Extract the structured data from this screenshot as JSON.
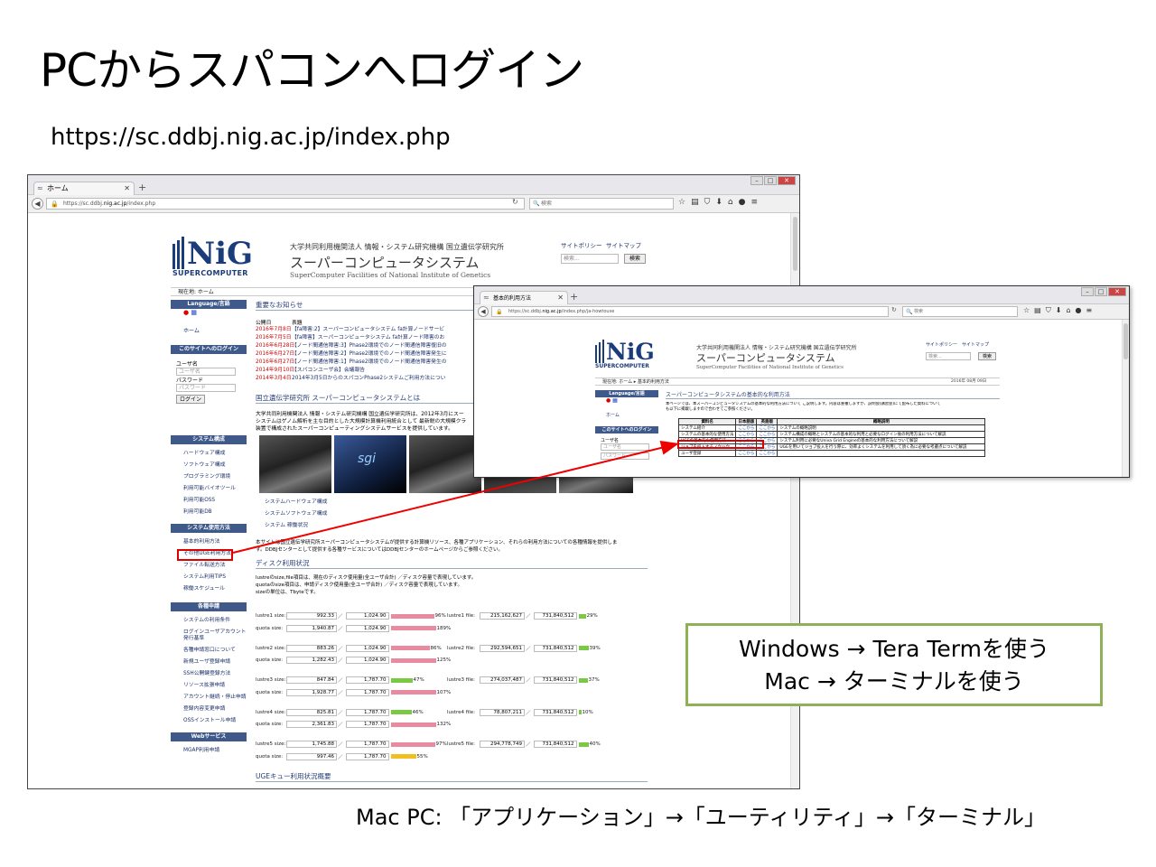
{
  "slide": {
    "title": "PCからスパコンへログイン",
    "url": "https://sc.ddbj.nig.ac.jp/index.php",
    "note_line1": "Windows → Tera Termを使う",
    "note_line2": "Mac → ターミナルを使う",
    "footer": "Mac PC: 「アプリケーション」→「ユーティリティ」→「ターミナル」"
  },
  "browser1": {
    "tab_label": "ホーム",
    "address_prefix": "https://sc.ddbj.",
    "address_domain": "nig.ac.jp",
    "address_suffix": "/index.php",
    "search_placeholder": "検索",
    "page": {
      "logo_text": "NiG",
      "logo_sub": "SUPERCOMPUTER",
      "org": "大学共同利用機関法人 情報・システム研究機構 国立遺伝学研究所",
      "system_name": "スーパーコンピュータシステム",
      "system_name_en": "SuperComputer Facilities of National Institute of Genetics",
      "links": [
        "サイトポリシー",
        "サイトマップ"
      ],
      "search_box": "検索...",
      "search_button": "検索",
      "breadcrumb": "現在地: ホーム",
      "sidebar": {
        "language_head": "Language/言語",
        "home": "ホーム",
        "login_head": "このサイトへのログイン",
        "user_label": "ユーザ名",
        "user_placeholder": "ユーザ名",
        "pass_label": "パスワード",
        "pass_placeholder": "パスワード",
        "login_button": "ログイン",
        "system_head": "システム構成",
        "system_items": [
          "ハードウェア構成",
          "ソフトウェア構成",
          "プログラミング環境",
          "利用可能バイオツール",
          "利用可能OSS",
          "利用可能DB"
        ],
        "usage_head": "システム使用方法",
        "usage_items": [
          "基本的利用方法",
          "その他UGE利用方法",
          "ファイル転送方法",
          "システム利用TIPS",
          "稼働スケジュール"
        ],
        "apply_head": "各種申請",
        "apply_items": [
          "システムの利用条件",
          "ログインユーザアカウント発行基準",
          "各種申請窓口について",
          "新規ユーザ登録申請",
          "SSH公開鍵登録方法",
          "リソース拡張申請",
          "アカウント継続・停止申請",
          "登録内容変更申請",
          "OSSインストール申請"
        ],
        "web_head": "Webサービス",
        "web_items": [
          "MGAP利用申請"
        ]
      },
      "notice_title": "重要なお知らせ",
      "notice_header": [
        "公開日",
        "表題"
      ],
      "notices": [
        {
          "date": "2016年7月8日",
          "title": "【fa障害:2】スーパーコンピュータシステム fa計算ノードサービ"
        },
        {
          "date": "2016年7月5日",
          "title": "【fa障害】スーパーコンピュータシステム fa計算ノード障害のお"
        },
        {
          "date": "2016年6月28日",
          "title": "【ノード間通信障害:3】Phase2環境でのノード間通信障害復旧の"
        },
        {
          "date": "2016年6月27日",
          "title": "【ノード間通信障害:2】Phase2環境でのノード間通信障害発生に"
        },
        {
          "date": "2016年6月27日",
          "title": "【ノード間通信障害:1】Phase2環境でのノード間通信障害発生の"
        },
        {
          "date": "2014年9月10日",
          "title": "【スパコンユーザ会】会議報告"
        },
        {
          "date": "2014年3月4日",
          "title": "2014年3月5日からのスパコンPhase2システムご利用方法につい"
        }
      ],
      "about_title": "国立遺伝学研究所 スーパーコンピュータシステムとは",
      "about_text1": "大学共同利用機関法人 情報・システム研究機構 国立遺伝学研究所は、2012年3月にスー",
      "about_text2": "システムはゲノム解析を主な目的とした大規模計算機利用統合として 最新鋭の大規模クラ",
      "about_text3": "装置で構成されたスーパーコンピューティングシステムサービスを提供しています。",
      "photo_links": [
        "システムハードウェア構成",
        "システムソフトウェア構成",
        "システム 稼働状況"
      ],
      "service_text1": "本サイトは国立遺伝学研究所スーパーコンピュータシステムが提供する計算機リソース、各種アプリケーション、それらの利用方法についての各種情報を提供しま",
      "service_text2": "す。DDBJセンターとして提供する各種サービスについてはDDBJセンターのホームページからご参照ください。",
      "disk_title": "ディスク利用状況",
      "disk_text1": "lustreのsize,file項目は、現在のディスク使用量(全ユーザ合計) ／ディスク容量で表現しています。",
      "disk_text2": "quotaのsize項目は、申請ディスク使用量(全ユーザ合計) ／ディスク容量で表現しています。",
      "disk_text3": "sizeの単位は、Tbyteです。",
      "disk_rows": [
        {
          "label": "lustre1 size:",
          "used": "992.33",
          "cap": "1,024.90",
          "pct": "96%",
          "ratio": 0.96,
          "color": "#e88aa0"
        },
        {
          "label": "quota size:",
          "used": "1,940.87",
          "cap": "1,024.90",
          "pct": "189%",
          "ratio": 1.0,
          "color": "#e88aa0"
        },
        {
          "label": "lustre2 size:",
          "used": "883.26",
          "cap": "1,024.90",
          "pct": "86%",
          "ratio": 0.86,
          "color": "#e88aa0"
        },
        {
          "label": "quota size:",
          "used": "1,282.43",
          "cap": "1,024.90",
          "pct": "125%",
          "ratio": 1.0,
          "color": "#e88aa0"
        },
        {
          "label": "lustre3 size:",
          "used": "847.84",
          "cap": "1,787.70",
          "pct": "47%",
          "ratio": 0.47,
          "color": "#7ac943"
        },
        {
          "label": "quota size:",
          "used": "1,928.77",
          "cap": "1,787.70",
          "pct": "107%",
          "ratio": 1.0,
          "color": "#e88aa0"
        },
        {
          "label": "lustre4 size:",
          "used": "825.81",
          "cap": "1,787.70",
          "pct": "46%",
          "ratio": 0.46,
          "color": "#7ac943"
        },
        {
          "label": "quota size:",
          "used": "2,361.83",
          "cap": "1,787.70",
          "pct": "132%",
          "ratio": 1.0,
          "color": "#e88aa0"
        },
        {
          "label": "lustre5 size:",
          "used": "1,745.88",
          "cap": "1,787.70",
          "pct": "97%",
          "ratio": 0.97,
          "color": "#e88aa0"
        },
        {
          "label": "quota size:",
          "used": "997.46",
          "cap": "1,787.70",
          "pct": "55%",
          "ratio": 0.55,
          "color": "#f0c020"
        }
      ],
      "file_rows": [
        {
          "label": "lustre1 file:",
          "used": "215,162,627",
          "cap": "731,840,512",
          "pct": "29%",
          "ratio": 0.29,
          "color": "#7ac943"
        },
        {
          "label": "lustre2 file:",
          "used": "292,594,651",
          "cap": "731,840,512",
          "pct": "39%",
          "ratio": 0.39,
          "color": "#7ac943"
        },
        {
          "label": "lustre3 file:",
          "used": "274,037,487",
          "cap": "731,840,512",
          "pct": "37%",
          "ratio": 0.37,
          "color": "#7ac943"
        },
        {
          "label": "lustre4 file:",
          "used": "78,807,211",
          "cap": "731,840,512",
          "pct": "10%",
          "ratio": 0.1,
          "color": "#7ac943"
        },
        {
          "label": "lustre5 file:",
          "used": "294,778,749",
          "cap": "731,840,512",
          "pct": "40%",
          "ratio": 0.4,
          "color": "#7ac943"
        }
      ],
      "uge_title": "UGEキュー利用状況概要"
    }
  },
  "browser2": {
    "tab_label": "基本的利用方法",
    "address_prefix": "https://sc.ddbj.",
    "address_domain": "nig.ac.jp",
    "address_suffix": "/index.php/ja-howtouse",
    "search_placeholder": "検索",
    "page": {
      "logo_text": "NiG",
      "logo_sub": "SUPERCOMPUTER",
      "org": "大学共同利用機関法人 情報・システム研究機構 国立遺伝学研究所",
      "system_name": "スーパーコンピュータシステム",
      "system_name_en": "SuperComputer Facilities of National Institute of Genetics",
      "links": [
        "サイトポリシー",
        "サイトマップ"
      ],
      "search_box": "検索...",
      "search_button": "検索",
      "breadcrumb": "現在地: ホーム ▸ 基本的利用方法",
      "date": "2016年 08月 09日",
      "sidebar": {
        "language_head": "Language/言語",
        "home": "ホーム",
        "login_head": "このサイトへのログイン",
        "user_label": "ユーザ名",
        "user_placeholder": "ユーザ名",
        "pass_placeholder": "パスワード"
      },
      "heading": "スーパーコンピュータシステムの基本的な利用方法",
      "intro1": "本ページでは、本スーパーコンピュータシステムの基本的な利用方法について ご説明します。内容は重複しますが、説明会(講習会)にて配布した資料について",
      "intro2": "も以下に掲載しますので合わせてご参照ください。",
      "table_headers": [
        "資料名",
        "日本語版",
        "英語版",
        "概略説明"
      ],
      "table_rows": [
        [
          "システム紹介",
          "ここから",
          "ここから",
          "システムの概略説明"
        ],
        [
          "システムの基本的な使用方法",
          "ここから",
          "ここから",
          "システム構成の概略とシステムの基本的な利用と必要なログイン後の利用方法について解説"
        ],
        [
          "UGEの基本的な使用方法",
          "ここから",
          "ここから",
          "システム利用に必要なUniva Grid Engineの基本的な利用方法について解説"
        ],
        [
          "ジョブを投入するノウハウ",
          "ここから",
          "ここから",
          "UGEを用いてジョブ投入を行う際に、効率よくシステムを利用して頂く為に必要な考慮点について解説"
        ],
        [
          "ユーザ登録",
          "ここから",
          "ここから",
          ""
        ]
      ]
    }
  },
  "colors": {
    "note_border": "#8db255",
    "highlight": "#dd0000",
    "sidebar_head": "#3f5a8a",
    "logo": "#1a3c7a"
  }
}
